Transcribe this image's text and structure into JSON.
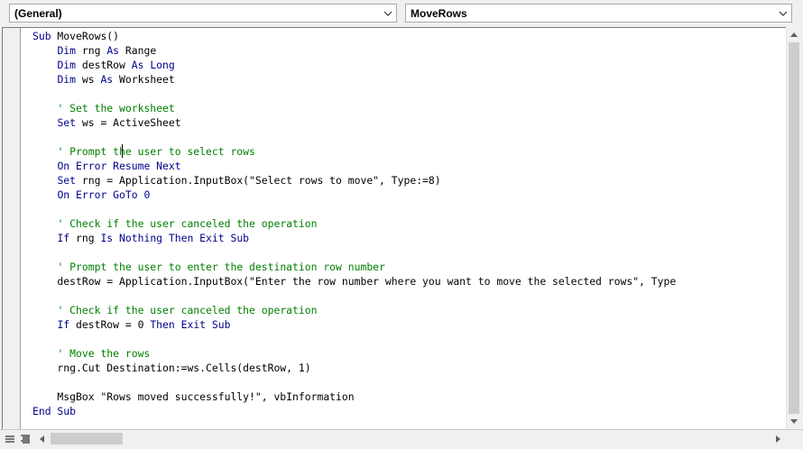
{
  "object_dropdown": {
    "value": "(General)",
    "icon": "chevron-down-icon"
  },
  "procedure_dropdown": {
    "value": "MoveRows",
    "icon": "chevron-down-icon"
  },
  "code_lines": [
    [
      {
        "t": "Sub",
        "c": "kw"
      },
      {
        "t": " MoveRows()",
        "c": ""
      }
    ],
    [
      {
        "t": "    ",
        "c": ""
      },
      {
        "t": "Dim",
        "c": "kw"
      },
      {
        "t": " rng ",
        "c": ""
      },
      {
        "t": "As",
        "c": "kw"
      },
      {
        "t": " Range",
        "c": ""
      }
    ],
    [
      {
        "t": "    ",
        "c": ""
      },
      {
        "t": "Dim",
        "c": "kw"
      },
      {
        "t": " destRow ",
        "c": ""
      },
      {
        "t": "As",
        "c": "kw"
      },
      {
        "t": " ",
        "c": ""
      },
      {
        "t": "Long",
        "c": "kw"
      }
    ],
    [
      {
        "t": "    ",
        "c": ""
      },
      {
        "t": "Dim",
        "c": "kw"
      },
      {
        "t": " ws ",
        "c": ""
      },
      {
        "t": "As",
        "c": "kw"
      },
      {
        "t": " Worksheet",
        "c": ""
      }
    ],
    [],
    [
      {
        "t": "    ",
        "c": ""
      },
      {
        "t": "' Set the worksheet",
        "c": "cm"
      }
    ],
    [
      {
        "t": "    ",
        "c": ""
      },
      {
        "t": "Set",
        "c": "kw"
      },
      {
        "t": " ws = ActiveSheet",
        "c": ""
      }
    ],
    [],
    [
      {
        "t": "    ",
        "c": ""
      },
      {
        "t": "' Prompt the user to select rows",
        "c": "cm"
      }
    ],
    [
      {
        "t": "    ",
        "c": ""
      },
      {
        "t": "On Error Resume Next",
        "c": "kw"
      }
    ],
    [
      {
        "t": "    ",
        "c": ""
      },
      {
        "t": "Set",
        "c": "kw"
      },
      {
        "t": " rng = Application.InputBox(\"Select rows to move\", Type:=8)",
        "c": ""
      }
    ],
    [
      {
        "t": "    ",
        "c": ""
      },
      {
        "t": "On Error GoTo 0",
        "c": "kw"
      }
    ],
    [],
    [
      {
        "t": "    ",
        "c": ""
      },
      {
        "t": "' Check if the user canceled the operation",
        "c": "cm"
      }
    ],
    [
      {
        "t": "    ",
        "c": ""
      },
      {
        "t": "If",
        "c": "kw"
      },
      {
        "t": " rng ",
        "c": ""
      },
      {
        "t": "Is Nothing Then Exit Sub",
        "c": "kw"
      }
    ],
    [],
    [
      {
        "t": "    ",
        "c": ""
      },
      {
        "t": "' Prompt the user to enter the destination row number",
        "c": "cm"
      }
    ],
    [
      {
        "t": "    destRow = Application.InputBox(\"Enter the row number where you want to move the selected rows\", Type",
        "c": ""
      }
    ],
    [],
    [
      {
        "t": "    ",
        "c": ""
      },
      {
        "t": "' Check if the user canceled the operation",
        "c": "cm"
      }
    ],
    [
      {
        "t": "    ",
        "c": ""
      },
      {
        "t": "If",
        "c": "kw"
      },
      {
        "t": " destRow = 0 ",
        "c": ""
      },
      {
        "t": "Then Exit Sub",
        "c": "kw"
      }
    ],
    [],
    [
      {
        "t": "    ",
        "c": ""
      },
      {
        "t": "' Move the rows",
        "c": "cm"
      }
    ],
    [
      {
        "t": "    rng.Cut Destination:=ws.Cells(destRow, 1)",
        "c": ""
      }
    ],
    [],
    [
      {
        "t": "    MsgBox \"Rows moved successfully!\", vbInformation",
        "c": ""
      }
    ],
    [
      {
        "t": "End Sub",
        "c": "kw"
      }
    ]
  ],
  "colors": {
    "keyword": "#00008b",
    "comment": "#008000",
    "text": "#000000"
  }
}
